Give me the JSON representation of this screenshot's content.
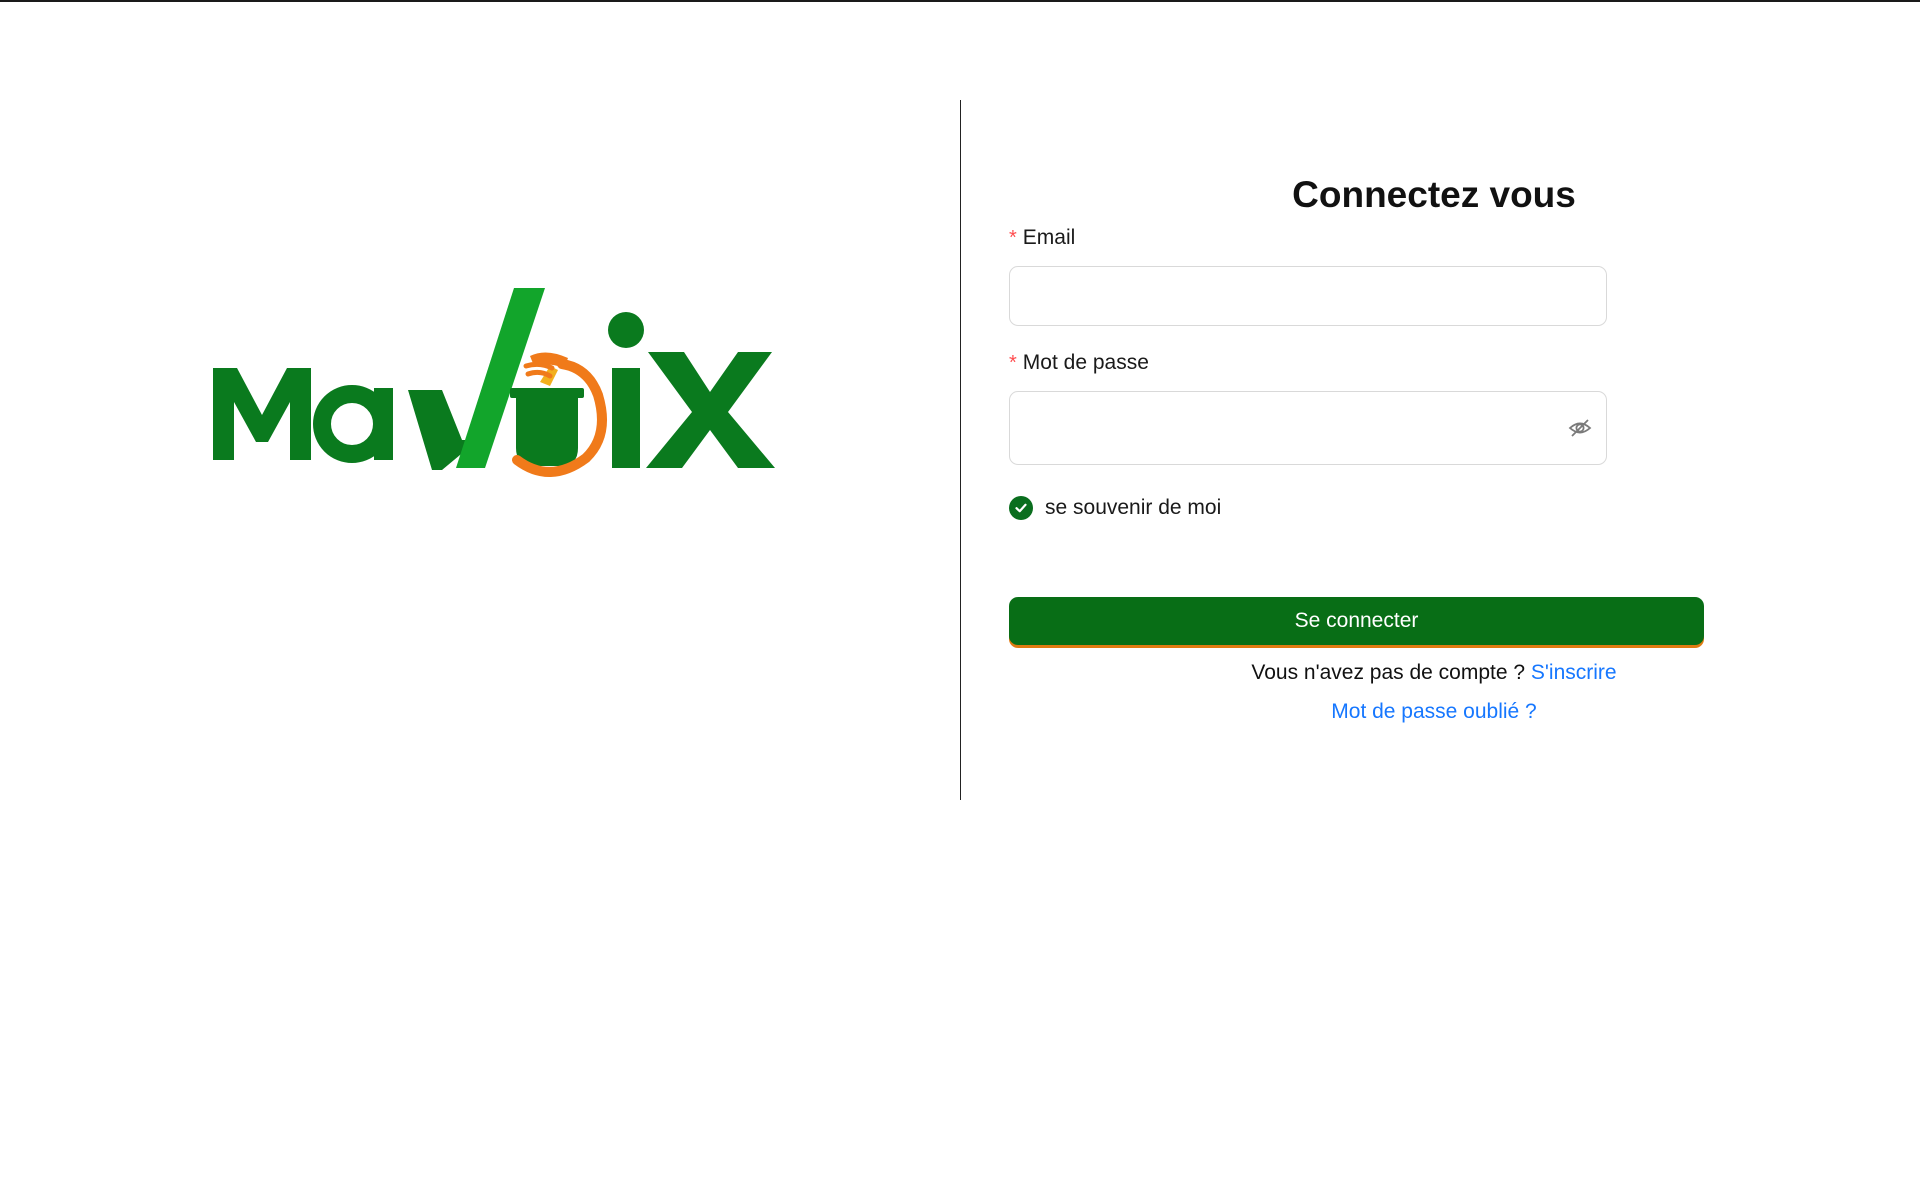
{
  "brand": {
    "logo_text": "MaVoix",
    "colors": {
      "green": "#0a7a1e",
      "light_green": "#12a52b",
      "orange": "#f07a1a",
      "yellow": "#f2b01e"
    }
  },
  "login": {
    "title": "Connectez vous",
    "email": {
      "label": "Email",
      "required_mark": "*",
      "value": "",
      "placeholder": ""
    },
    "password": {
      "label": "Mot de passe",
      "required_mark": "*",
      "value": "",
      "placeholder": "",
      "toggle_icon": "eye-invisible-icon"
    },
    "remember": {
      "label": "se souvenir de moi",
      "checked": true,
      "icon": "check-circle-icon"
    },
    "submit_label": "Se connecter",
    "signup_prompt": "Vous n'avez pas de compte ?",
    "signup_link": "S'inscrire",
    "forgot_link": "Mot de passe oublié ?"
  },
  "colors": {
    "primary_button": "#086e16",
    "button_accent": "#e07b12",
    "link": "#1677ff",
    "required": "#ff4d4f"
  }
}
